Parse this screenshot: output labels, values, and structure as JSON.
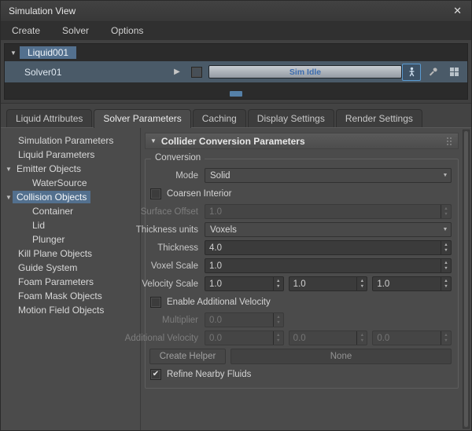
{
  "window": {
    "title": "Simulation View",
    "close_glyph": "✕"
  },
  "menubar": {
    "items": [
      "Create",
      "Solver",
      "Options"
    ]
  },
  "glyphs": {
    "expanded": "▼",
    "play": "▶",
    "dropdown": "▼",
    "spin_up": "▲",
    "spin_down": "▼",
    "check": "✔"
  },
  "solver_panel": {
    "root_node": "Liquid001",
    "solver_name": "Solver01",
    "status_text": "Sim Idle"
  },
  "tabs": {
    "items": [
      {
        "label": "Liquid Attributes",
        "active": false
      },
      {
        "label": "Solver Parameters",
        "active": true
      },
      {
        "label": "Caching",
        "active": false
      },
      {
        "label": "Display Settings",
        "active": false
      },
      {
        "label": "Render Settings",
        "active": false
      }
    ]
  },
  "tree": {
    "items": [
      {
        "label": "Simulation Parameters",
        "indent": 1,
        "selected": false
      },
      {
        "label": "Liquid Parameters",
        "indent": 1,
        "selected": false
      },
      {
        "label": "Emitter Objects",
        "indent": 0,
        "expanded": true,
        "selected": false
      },
      {
        "label": "WaterSource",
        "indent": 2,
        "selected": false
      },
      {
        "label": "Collision Objects",
        "indent": 0,
        "expanded": true,
        "selected": true
      },
      {
        "label": "Container",
        "indent": 2,
        "selected": false
      },
      {
        "label": "Lid",
        "indent": 2,
        "selected": false
      },
      {
        "label": "Plunger",
        "indent": 2,
        "selected": false
      },
      {
        "label": "Kill Plane Objects",
        "indent": 1,
        "selected": false
      },
      {
        "label": "Guide System",
        "indent": 1,
        "selected": false
      },
      {
        "label": "Foam Parameters",
        "indent": 1,
        "selected": false
      },
      {
        "label": "Foam Mask Objects",
        "indent": 1,
        "selected": false
      },
      {
        "label": "Motion Field Objects",
        "indent": 1,
        "selected": false
      }
    ]
  },
  "rollout": {
    "title": "Collider Conversion Parameters"
  },
  "conversion": {
    "group_label": "Conversion",
    "mode": {
      "label": "Mode",
      "value": "Solid"
    },
    "coarsen_interior": {
      "label": "Coarsen Interior",
      "checked": false
    },
    "surface_offset": {
      "label": "Surface Offset",
      "value": "1.0",
      "disabled": true
    },
    "thickness_units": {
      "label": "Thickness units",
      "value": "Voxels"
    },
    "thickness": {
      "label": "Thickness",
      "value": "4.0"
    },
    "voxel_scale": {
      "label": "Voxel Scale",
      "value": "1.0"
    },
    "velocity_scale": {
      "label": "Velocity Scale",
      "values": [
        "1.0",
        "1.0",
        "1.0"
      ]
    },
    "enable_additional_velocity": {
      "label": "Enable Additional Velocity",
      "checked": false
    },
    "multiplier": {
      "label": "Multiplier",
      "value": "0.0",
      "disabled": true
    },
    "additional_velocity": {
      "label": "Additional Velocity",
      "values": [
        "0.0",
        "0.0",
        "0.0"
      ],
      "disabled": true
    },
    "create_helper": {
      "label": "Create Helper"
    },
    "helper_target": {
      "label": "None"
    },
    "refine_nearby_fluids": {
      "label": "Refine Nearby Fluids",
      "checked": true
    }
  },
  "colors": {
    "selection": "#53708e",
    "accent_blue": "#5b9bd1",
    "status_text": "#3c6cae"
  }
}
